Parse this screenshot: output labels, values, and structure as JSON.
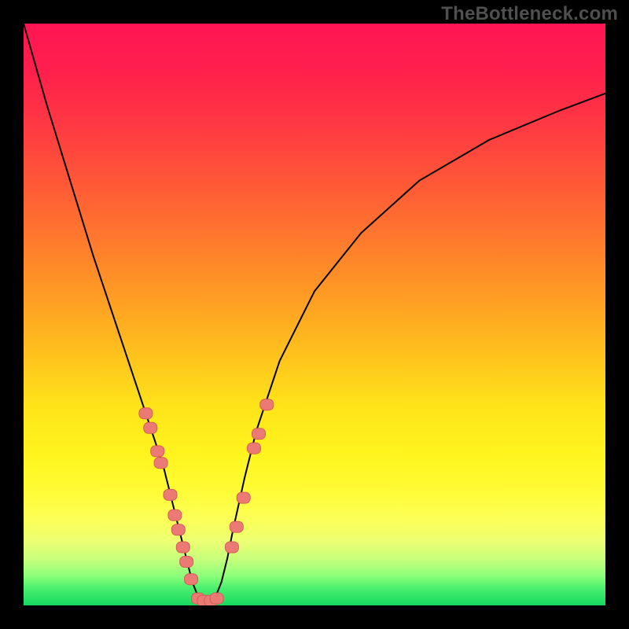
{
  "watermark": "TheBottleneck.com",
  "colors": {
    "frame_bg": "#000000",
    "watermark_text": "#4f4f4f",
    "curve_stroke": "#000000",
    "bead_fill": "#ec7a74",
    "bead_stroke": "#d35e58",
    "gradient_top": "#ff1554",
    "gradient_bottom": "#13d95f"
  },
  "chart_data": {
    "type": "line",
    "title": "",
    "xlabel": "",
    "ylabel": "",
    "x_range": [
      0,
      100
    ],
    "y_range": [
      0,
      100
    ],
    "description": "V-shaped bottleneck curve with vertex near the bottom indicating the balanced configuration. Values read from pixel positions; axes unlabeled so units are percent of plot area.",
    "series": [
      {
        "name": "bottleneck_curve",
        "x": [
          0,
          4,
          8,
          12,
          16,
          18,
          20,
          22,
          23,
          24,
          25,
          26,
          27,
          28,
          29,
          30,
          31,
          32,
          33,
          34,
          35,
          36,
          38,
          40,
          44,
          50,
          58,
          68,
          80,
          92,
          100
        ],
        "y": [
          100,
          86,
          73,
          60,
          48,
          42,
          36,
          30,
          27,
          24,
          20,
          16,
          12,
          8,
          4,
          1.5,
          0.8,
          0.8,
          1.5,
          4,
          8,
          13,
          22,
          30,
          42,
          54,
          64,
          73,
          80,
          85,
          88
        ]
      }
    ],
    "markers": [
      {
        "series": "left_arm",
        "x": 21.0,
        "y": 33.0
      },
      {
        "series": "left_arm",
        "x": 21.8,
        "y": 30.5
      },
      {
        "series": "left_arm",
        "x": 23.0,
        "y": 26.5
      },
      {
        "series": "left_arm",
        "x": 23.6,
        "y": 24.5
      },
      {
        "series": "left_arm",
        "x": 25.2,
        "y": 19.0
      },
      {
        "series": "left_arm",
        "x": 26.0,
        "y": 15.5
      },
      {
        "series": "left_arm",
        "x": 26.6,
        "y": 13.0
      },
      {
        "series": "left_arm",
        "x": 27.4,
        "y": 10.0
      },
      {
        "series": "left_arm",
        "x": 28.0,
        "y": 7.5
      },
      {
        "series": "left_arm",
        "x": 28.8,
        "y": 4.5
      },
      {
        "series": "vertex",
        "x": 30.0,
        "y": 1.2
      },
      {
        "series": "vertex",
        "x": 31.0,
        "y": 0.8
      },
      {
        "series": "vertex",
        "x": 32.2,
        "y": 0.8
      },
      {
        "series": "vertex",
        "x": 33.2,
        "y": 1.2
      },
      {
        "series": "right_arm",
        "x": 35.8,
        "y": 10.0
      },
      {
        "series": "right_arm",
        "x": 36.6,
        "y": 13.5
      },
      {
        "series": "right_arm",
        "x": 37.8,
        "y": 18.5
      },
      {
        "series": "right_arm",
        "x": 39.6,
        "y": 27.0
      },
      {
        "series": "right_arm",
        "x": 40.4,
        "y": 29.5
      },
      {
        "series": "right_arm",
        "x": 41.8,
        "y": 34.5
      }
    ]
  }
}
